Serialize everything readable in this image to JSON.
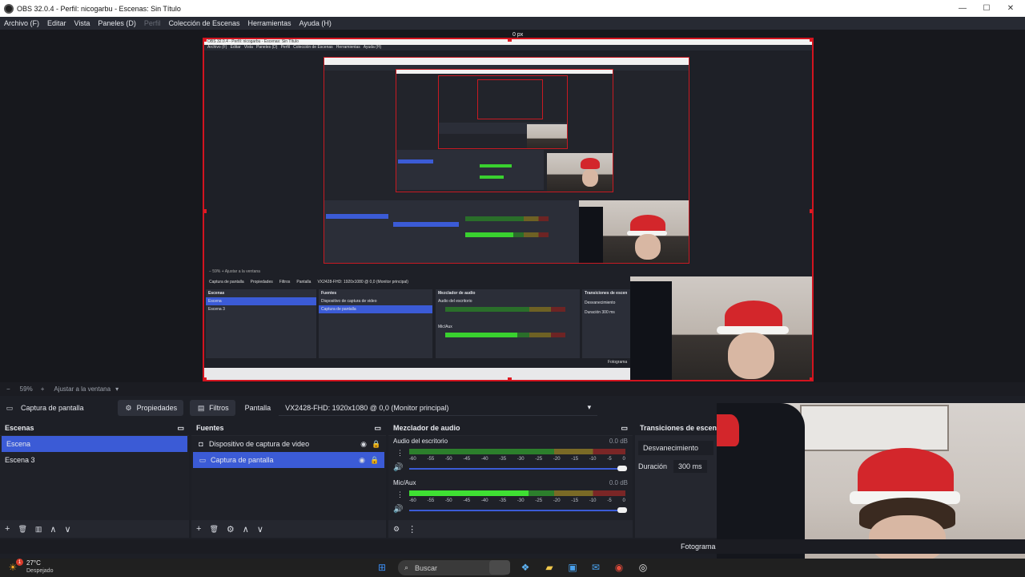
{
  "window": {
    "title": "OBS 32.0.4 - Perfil: nicogarbu - Escenas: Sin Título",
    "controls": {
      "minimize": "—",
      "maximize": "☐",
      "close": "✕"
    }
  },
  "menu": {
    "items": [
      "Archivo (F)",
      "Editar",
      "Vista",
      "Paneles (D)",
      "Perfil",
      "Colección de Escenas",
      "Herramientas",
      "Ayuda (H)"
    ]
  },
  "preview": {
    "zoom_minus": "−",
    "zoom": "59%",
    "zoom_plus": "+",
    "fit_label": "Ajustar a la ventana",
    "size_label": "0 px",
    "nested_title": "OBS 32.0.4 - Perfil: nicogarbu - Escenas: Sin Título",
    "nested_menu": "Archivo (F)   Editar   Vista   Paneles (D)   Perfil   Colección de Escenas   Herramientas   Ayuda (H)",
    "nested_source": "Captura de pantalla",
    "nested_props": "Propiedades",
    "nested_filters": "Filtros",
    "nested_display": "Pantalla",
    "nested_monitor": "VX2428-FHD: 1920x1080 @ 0,0 (Monitor principal)",
    "nested_scenes_title": "Escenas",
    "nested_scene_1": "Escena",
    "nested_scene_2": "Escena 3",
    "nested_sources_title": "Fuentes",
    "nested_source_1": "Dispositivo de captura de video",
    "nested_source_2": "Captura de pantalla",
    "nested_mixer_title": "Mezclador de audio",
    "nested_audio_1": "Audio del escritorio",
    "nested_audio_2": "Mic/Aux",
    "nested_transitions_title": "Transiciones de escen",
    "nested_fade": "Desvanecimiento",
    "nested_duration": "Duración",
    "nested_duration_val": "300 ms",
    "nested_fotograma": "Fotograma"
  },
  "source_toolbar": {
    "source_name": "Captura de pantalla",
    "properties": "Propiedades",
    "filters": "Filtros",
    "display_label": "Pantalla",
    "display_value": "VX2428-FHD: 1920x1080 @ 0,0 (Monitor principal)"
  },
  "scenes": {
    "title": "Escenas",
    "items": [
      {
        "label": "Escena",
        "selected": true
      },
      {
        "label": "Escena 3",
        "selected": false
      }
    ],
    "footer": [
      "+",
      "🗑",
      "▥",
      "∧",
      "∨"
    ]
  },
  "sources": {
    "title": "Fuentes",
    "items": [
      {
        "label": "Dispositivo de captura de video",
        "icon": "camera-icon",
        "selected": false
      },
      {
        "label": "Captura de pantalla",
        "icon": "monitor-icon",
        "selected": true
      }
    ],
    "footer": [
      "+",
      "🗑",
      "⚙",
      "∧",
      "∨"
    ]
  },
  "mixer": {
    "title": "Mezclador de audio",
    "channels": [
      {
        "name": "Audio del escritorio",
        "db": "0.0 dB",
        "level": 0.0
      },
      {
        "name": "Mic/Aux",
        "db": "0.0 dB",
        "level": 0.55
      }
    ],
    "ticks": [
      "-60",
      "-55",
      "-50",
      "-45",
      "-40",
      "-35",
      "-30",
      "-25",
      "-20",
      "-15",
      "-10",
      "-5",
      "0"
    ]
  },
  "transitions": {
    "title": "Transiciones de escen",
    "selected": "Desvanecimiento",
    "duration_label": "Duración",
    "duration_value": "300 ms"
  },
  "status": {
    "fotograma": "Fotograma"
  },
  "taskbar": {
    "weather_temp": "27°C",
    "weather_desc": "Despejado",
    "weather_badge": "1",
    "search_placeholder": "Buscar"
  }
}
